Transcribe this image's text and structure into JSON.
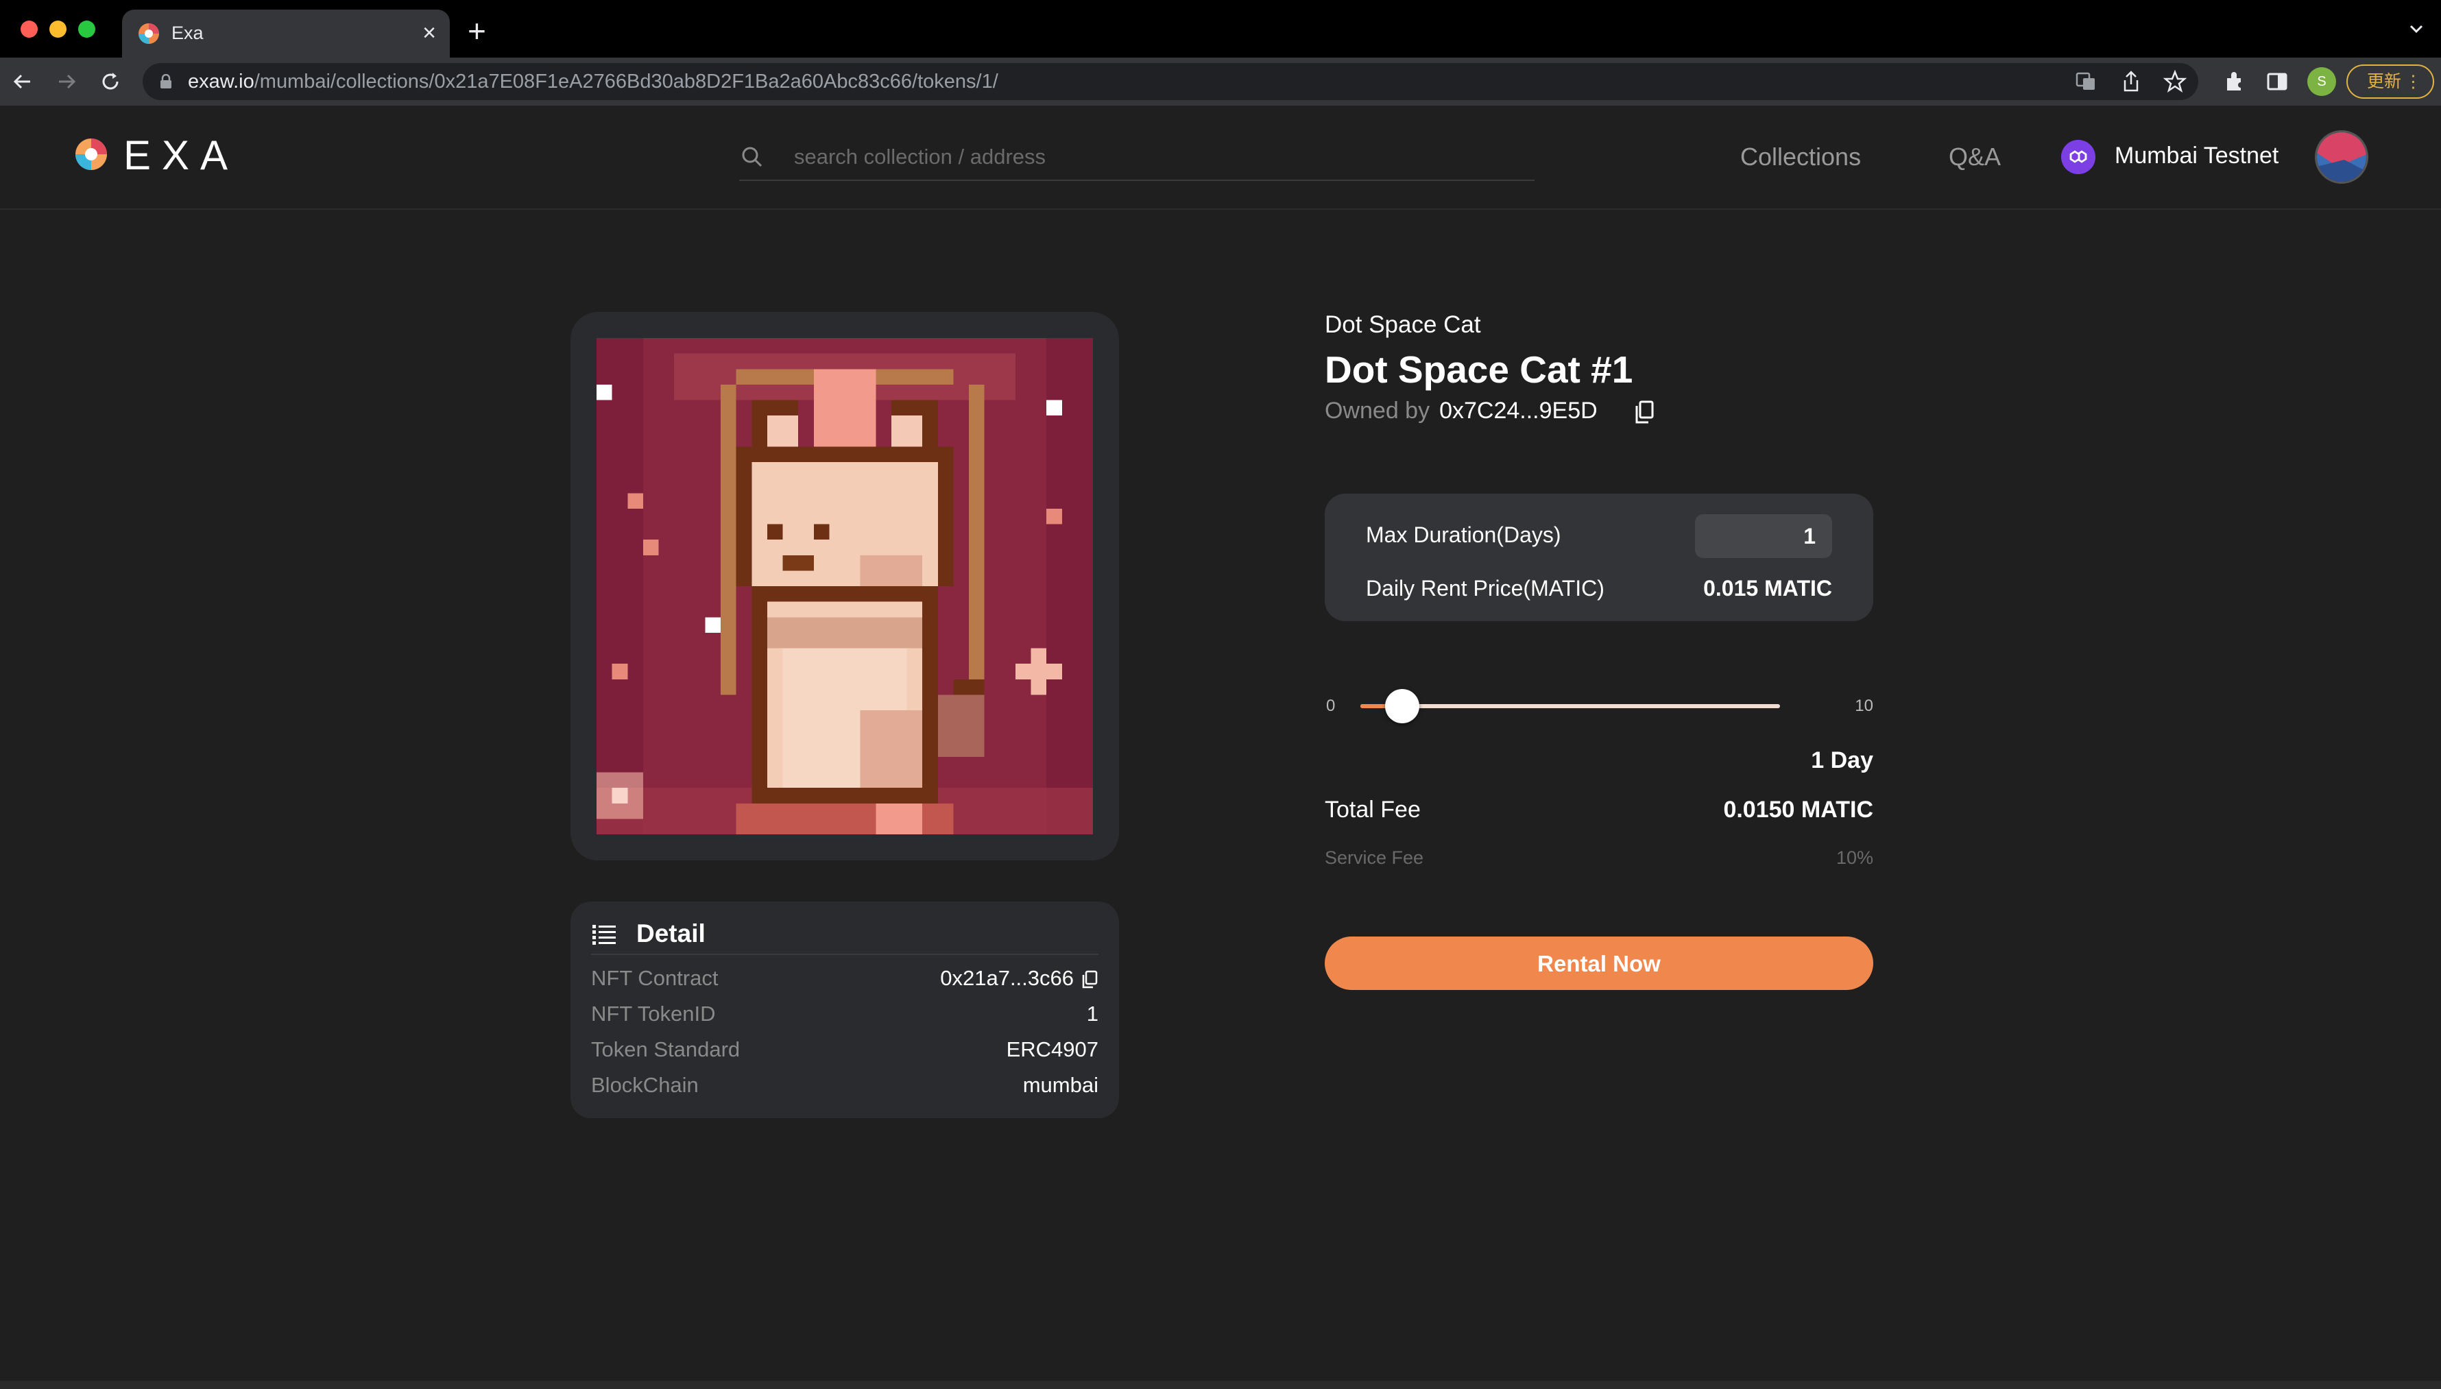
{
  "browser": {
    "tab_title": "Exa",
    "url_host": "exaw.io",
    "url_path": "/mumbai/collections/0x21a7E08F1eA2766Bd30ab8D2F1Ba2a60Abc83c66/tokens/1/",
    "profile_initial": "S",
    "update_label": "更新"
  },
  "header": {
    "logo_text": "EXA",
    "search_placeholder": "search collection / address",
    "nav_collections": "Collections",
    "nav_qa": "Q&A",
    "network": "Mumbai Testnet"
  },
  "token": {
    "collection": "Dot Space Cat",
    "title": "Dot Space Cat #1",
    "owned_by_label": "Owned by",
    "owner": "0x7C24...9E5D"
  },
  "detail": {
    "title": "Detail",
    "rows": [
      {
        "label": "NFT Contract",
        "value": "0x21a7...3c66"
      },
      {
        "label": "NFT TokenID",
        "value": "1"
      },
      {
        "label": "Token Standard",
        "value": "ERC4907"
      },
      {
        "label": "BlockChain",
        "value": "mumbai"
      }
    ]
  },
  "rental": {
    "max_duration_label": "Max Duration(Days)",
    "max_duration_value": "1",
    "daily_price_label": "Daily Rent Price(MATIC)",
    "daily_price_value": "0.015 MATIC",
    "slider_min": "0",
    "slider_max": "10",
    "slider_value": 1,
    "days_label": "1 Day",
    "total_fee_label": "Total Fee",
    "total_fee_value": "0.0150 MATIC",
    "service_fee_label": "Service Fee",
    "service_fee_value": "10%",
    "button_label": "Rental Now"
  },
  "colors": {
    "accent": "#f0884e",
    "background": "#1f1f1f",
    "card": "#2a2b2e",
    "network_badge": "#7b3fe4"
  }
}
